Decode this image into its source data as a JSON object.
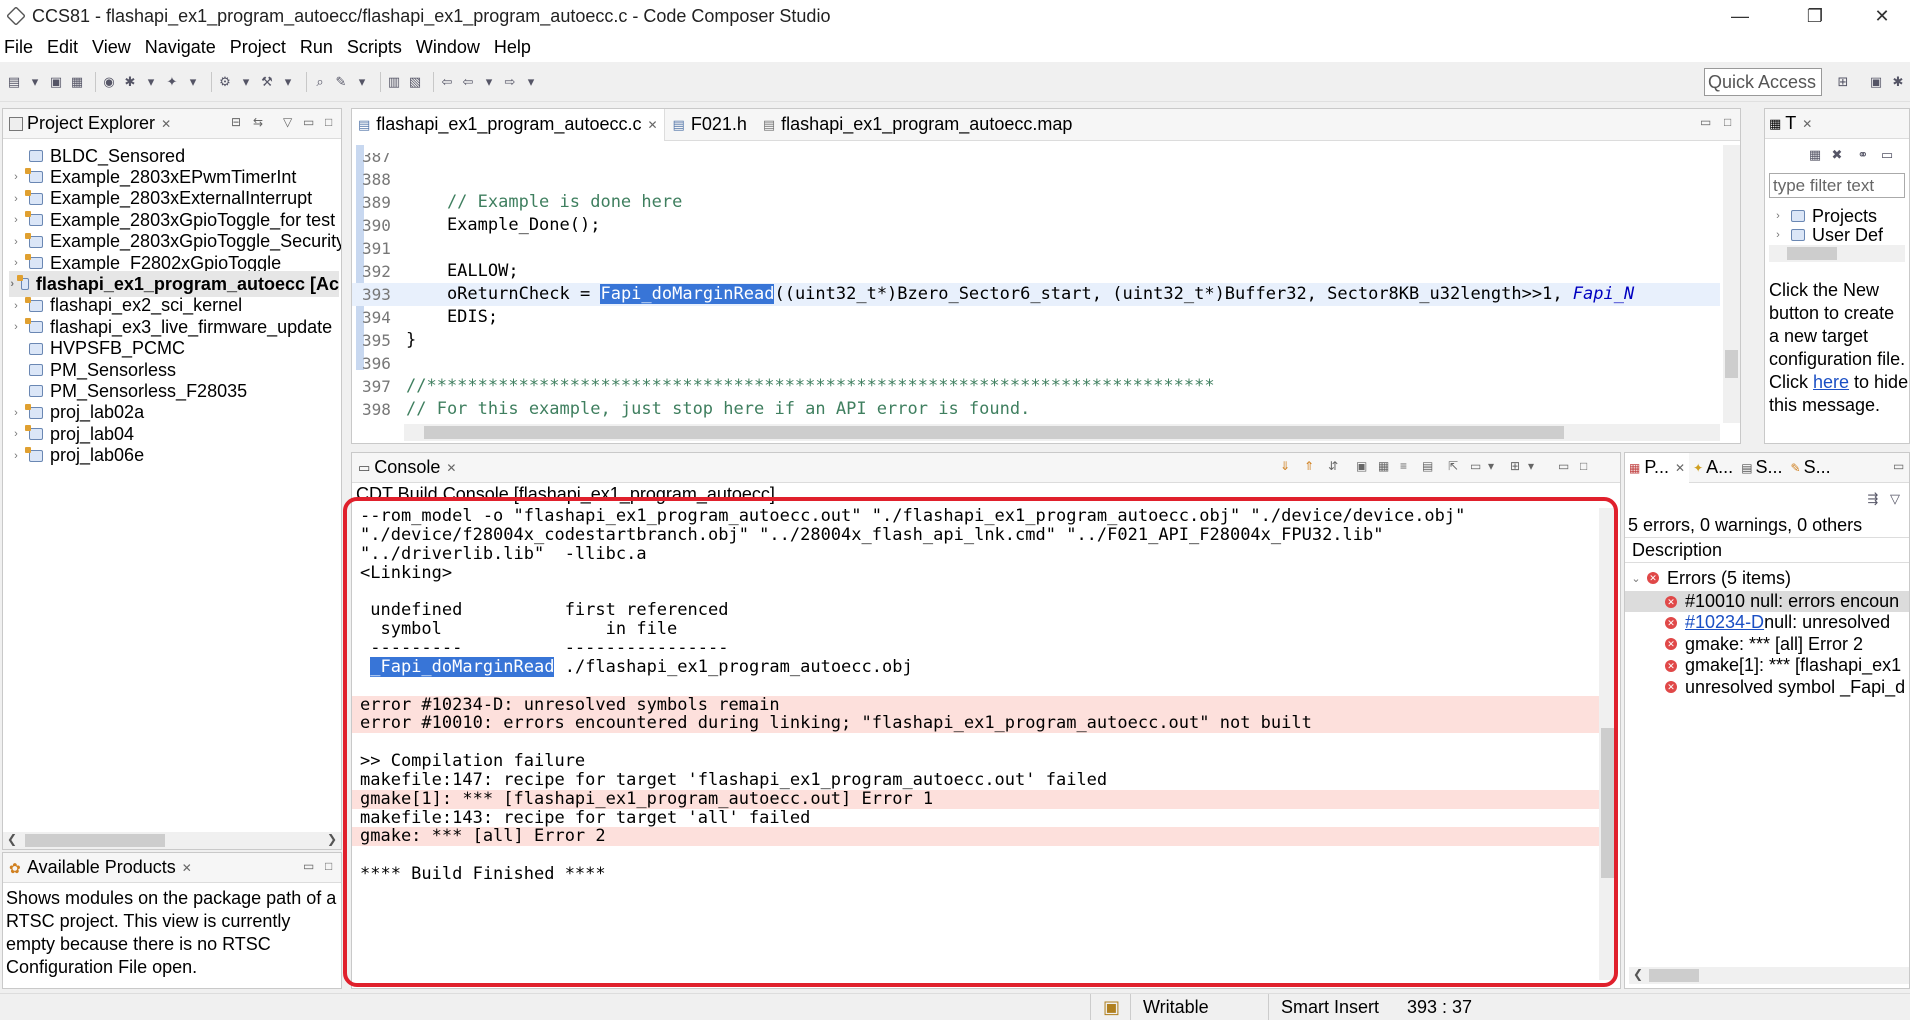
{
  "window": {
    "title": "CCS81 - flashapi_ex1_program_autoecc/flashapi_ex1_program_autoecc.c - Code Composer Studio",
    "minimize": "—",
    "restore": "❐",
    "close": "✕"
  },
  "menu": [
    "File",
    "Edit",
    "View",
    "Navigate",
    "Project",
    "Run",
    "Scripts",
    "Window",
    "Help"
  ],
  "toolbar": {
    "quick_access": "Quick Access"
  },
  "project_explorer": {
    "title": "Project Explorer",
    "items": [
      {
        "label": "BLDC_Sensored",
        "expandable": false,
        "bold": false
      },
      {
        "label": "Example_2803xEPwmTimerInt",
        "expandable": true,
        "bold": false
      },
      {
        "label": "Example_2803xExternalInterrupt",
        "expandable": true,
        "bold": false
      },
      {
        "label": "Example_2803xGpioToggle_for test",
        "expandable": true,
        "bold": false
      },
      {
        "label": "Example_2803xGpioToggle_Security",
        "expandable": true,
        "bold": false
      },
      {
        "label": "Example_F2802xGpioToggle",
        "expandable": true,
        "bold": false
      },
      {
        "label": "flashapi_ex1_program_autoecc  [Ac",
        "expandable": true,
        "bold": true
      },
      {
        "label": "flashapi_ex2_sci_kernel",
        "expandable": true,
        "bold": false
      },
      {
        "label": "flashapi_ex3_live_firmware_update",
        "expandable": true,
        "bold": false
      },
      {
        "label": "HVPSFB_PCMC",
        "expandable": false,
        "bold": false
      },
      {
        "label": "PM_Sensorless",
        "expandable": false,
        "bold": false
      },
      {
        "label": "PM_Sensorless_F28035",
        "expandable": false,
        "bold": false
      },
      {
        "label": "proj_lab02a",
        "expandable": true,
        "bold": false
      },
      {
        "label": "proj_lab04",
        "expandable": true,
        "bold": false
      },
      {
        "label": "proj_lab06e",
        "expandable": true,
        "bold": false
      }
    ]
  },
  "available_products": {
    "title": "Available Products",
    "message": "Shows modules on the package path of a RTSC project. This view is currently empty because there is no RTSC Configuration File open."
  },
  "editor": {
    "tabs": [
      {
        "label": "flashapi_ex1_program_autoecc.c",
        "active": true
      },
      {
        "label": "F021.h",
        "active": false
      },
      {
        "label": "flashapi_ex1_program_autoecc.map",
        "active": false
      }
    ],
    "lines": [
      {
        "num": "387",
        "text": ""
      },
      {
        "num": "388",
        "text": ""
      },
      {
        "num": "389",
        "text": "    // Example is done here"
      },
      {
        "num": "390",
        "text": "    Example_Done();"
      },
      {
        "num": "391",
        "text": ""
      },
      {
        "num": "392",
        "text": "    EALLOW;"
      },
      {
        "num": "393",
        "pre": "    oReturnCheck = ",
        "hl": "Fapi_doMarginRead",
        "post": "((uint32_t*)Bzero_Sector6_start, (uint32_t*)Buffer32, Sector8KB_u32length>>1, ",
        "tail": "Fapi_N"
      },
      {
        "num": "394",
        "text": "    EDIS;"
      },
      {
        "num": "395",
        "text": "}"
      },
      {
        "num": "396",
        "text": ""
      },
      {
        "num": "397",
        "text": "//*****************************************************************************"
      },
      {
        "num": "398",
        "text": "// For this example, just stop here if an API error is found."
      }
    ]
  },
  "console": {
    "title": "Console",
    "subtitle": "CDT Build Console [flashapi_ex1_program_autoecc]",
    "lines": [
      {
        "text": "--rom_model -o \"flashapi_ex1_program_autoecc.out\" \"./flashapi_ex1_program_autoecc.obj\" \"./device/device.obj\"",
        "err": false
      },
      {
        "text": "\"./device/f28004x_codestartbranch.obj\" \"../28004x_flash_api_lnk.cmd\" \"../F021_API_F28004x_FPU32.lib\"",
        "err": false
      },
      {
        "text": "\"../driverlib.lib\"  -llibc.a",
        "err": false
      },
      {
        "text": "<Linking>",
        "err": false
      },
      {
        "text": "",
        "err": false
      },
      {
        "text": " undefined          first referenced",
        "err": false
      },
      {
        "text": "  symbol                in file",
        "err": false
      },
      {
        "text": " ---------          ----------------",
        "err": false
      },
      {
        "text": "",
        "err": false,
        "symbol": "_Fapi_doMarginRead",
        "file": " ./flashapi_ex1_program_autoecc.obj"
      },
      {
        "text": "",
        "err": false
      },
      {
        "text": "error #10234-D: unresolved symbols remain",
        "err": true
      },
      {
        "text": "error #10010: errors encountered during linking; \"flashapi_ex1_program_autoecc.out\" not built",
        "err": true
      },
      {
        "text": "",
        "err": false
      },
      {
        "text": ">> Compilation failure",
        "err": false
      },
      {
        "text": "makefile:147: recipe for target 'flashapi_ex1_program_autoecc.out' failed",
        "err": false
      },
      {
        "text": "gmake[1]: *** [flashapi_ex1_program_autoecc.out] Error 1",
        "err": true
      },
      {
        "text": "makefile:143: recipe for target 'all' failed",
        "err": false
      },
      {
        "text": "gmake: *** [all] Error 2",
        "err": true
      },
      {
        "text": "",
        "err": false
      },
      {
        "text": "**** Build Finished ****",
        "err": false
      }
    ]
  },
  "target_panel": {
    "title_short": "T",
    "filter_placeholder": "type filter text",
    "tree": [
      "Projects",
      "User Def"
    ],
    "message_pre": "Click the New button to create a new target configuration file. Click ",
    "message_link": "here",
    "message_post": " to hide this message."
  },
  "problems": {
    "tabs": [
      "P...",
      "A...",
      "S...",
      "S..."
    ],
    "summary": "5 errors, 0 warnings, 0 others",
    "column": "Description",
    "group": "Errors (5 items)",
    "items": [
      {
        "text": "#10010 null: errors encoun",
        "link": false,
        "selected": true
      },
      {
        "link_text": "#10234-D",
        "text": "  null: unresolved",
        "link": true,
        "selected": false
      },
      {
        "text": "gmake: *** [all] Error 2",
        "link": false,
        "selected": false
      },
      {
        "text": "gmake[1]: *** [flashapi_ex1",
        "link": false,
        "selected": false
      },
      {
        "text": "unresolved symbol _Fapi_d",
        "link": false,
        "selected": false
      }
    ]
  },
  "status": {
    "writable": "Writable",
    "insert": "Smart Insert",
    "position": "393 : 37"
  }
}
